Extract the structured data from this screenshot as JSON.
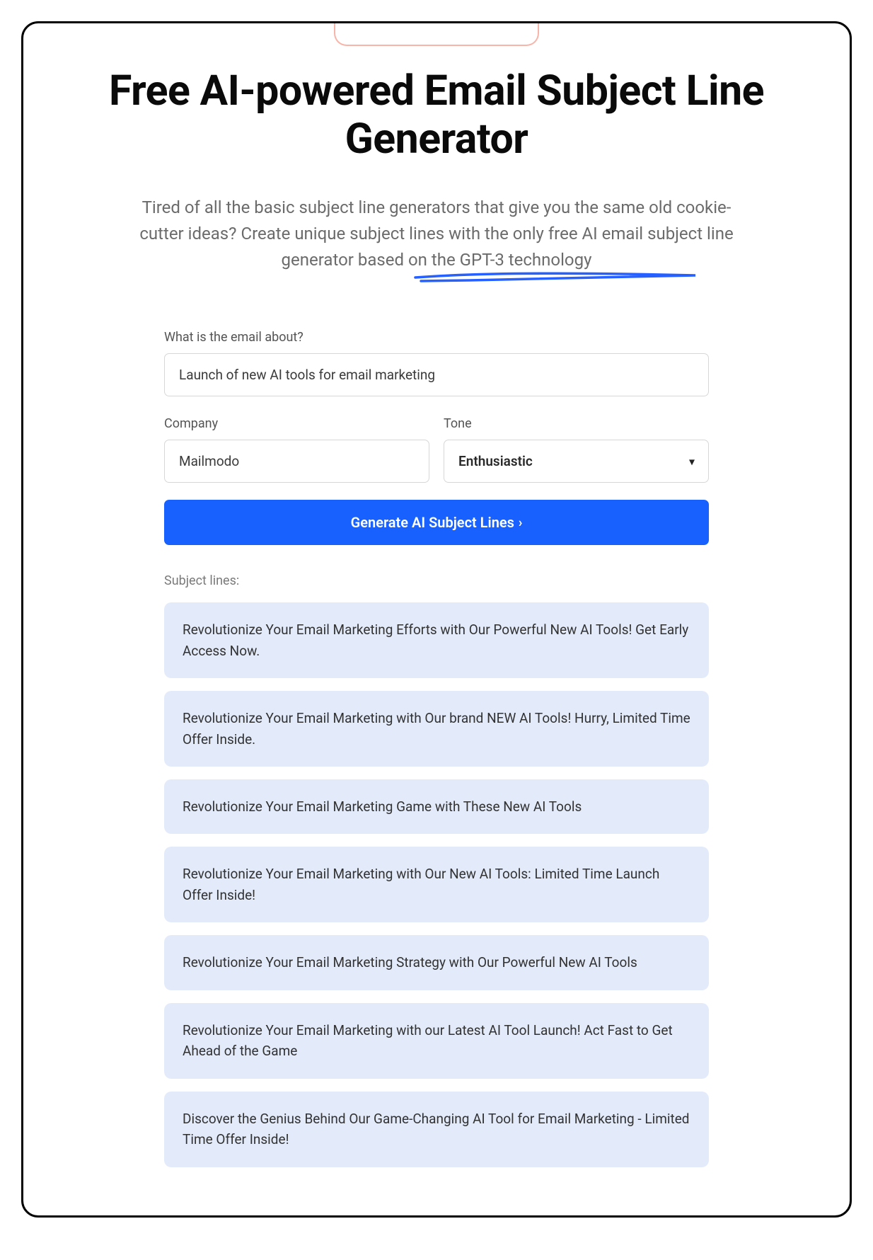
{
  "hero": {
    "title": "Free AI-powered Email Subject Line Generator",
    "subtitle": "Tired of all the basic subject line generators that give you the same old cookie-cutter ideas? Create unique subject lines with the only free AI email subject line generator based on the GPT-3 technology"
  },
  "form": {
    "about_label": "What is the email about?",
    "about_value": "Launch of new AI tools for email marketing",
    "company_label": "Company",
    "company_value": "Mailmodo",
    "tone_label": "Tone",
    "tone_value": "Enthusiastic",
    "generate_label": "Generate AI Subject Lines"
  },
  "results": {
    "label": "Subject lines:",
    "items": [
      "Revolutionize Your Email Marketing Efforts with Our Powerful New AI Tools! Get Early Access Now.",
      "Revolutionize Your Email Marketing with Our brand NEW AI Tools! Hurry, Limited Time Offer Inside.",
      "Revolutionize Your Email Marketing Game with These New AI Tools",
      "Revolutionize Your Email Marketing with Our New AI Tools: Limited Time Launch Offer Inside!",
      "Revolutionize Your Email Marketing Strategy with Our Powerful New AI Tools",
      "Revolutionize Your Email Marketing with our Latest AI Tool Launch! Act Fast to Get Ahead of the Game",
      "Discover the Genius Behind Our Game-Changing AI Tool for Email Marketing - Limited Time Offer Inside!"
    ]
  }
}
